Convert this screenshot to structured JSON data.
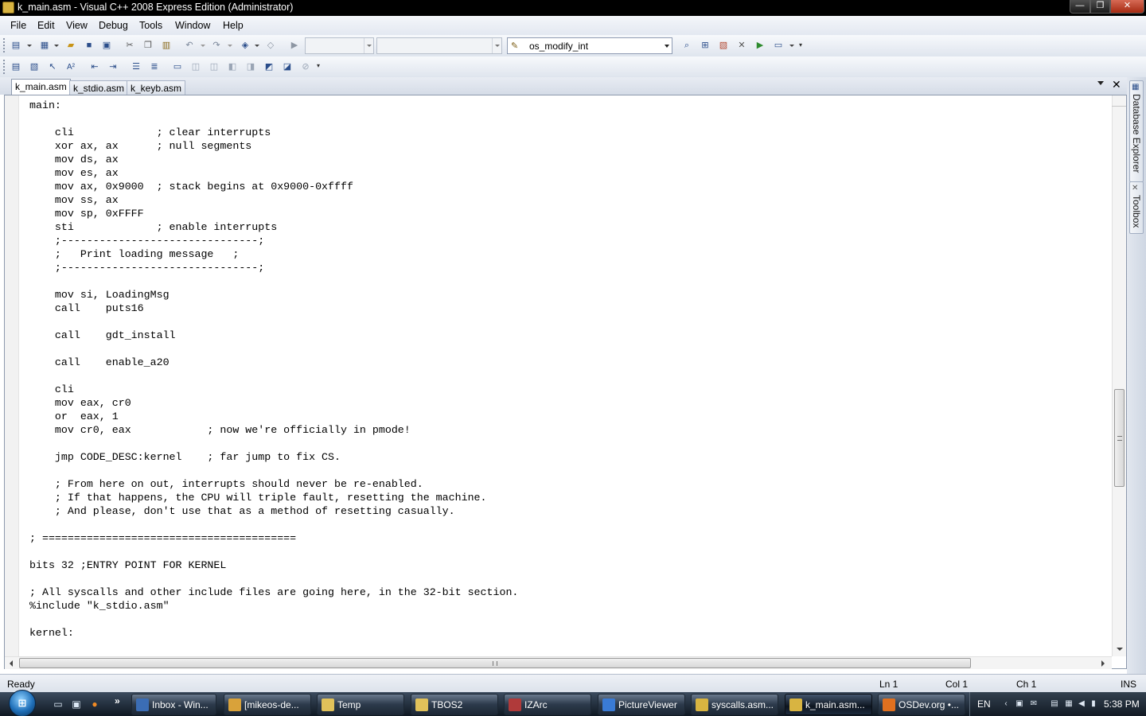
{
  "window": {
    "title": "k_main.asm - Visual C++ 2008 Express Edition (Administrator)",
    "minimize_glyph": "—",
    "maximize_glyph": "❐",
    "close_glyph": "✕"
  },
  "menu": {
    "items": [
      {
        "label": "File"
      },
      {
        "label": "Edit"
      },
      {
        "label": "View"
      },
      {
        "label": "Debug"
      },
      {
        "label": "Tools"
      },
      {
        "label": "Window"
      },
      {
        "label": "Help"
      }
    ]
  },
  "toolbar": {
    "find_value": "os_modify_int",
    "icons": [
      "new-project-icon",
      "add-item-icon",
      "open-file-icon",
      "save-icon",
      "save-all-icon",
      "cut-icon",
      "copy-icon",
      "paste-icon",
      "undo-icon",
      "redo-icon",
      "navigate-icon",
      "start-debug-icon",
      "find-in-files-icon",
      "solution-explorer-icon",
      "properties-icon",
      "toolbox-icon",
      "start-page-icon",
      "output-icon"
    ]
  },
  "tabs": [
    {
      "label": "k_main.asm",
      "active": true
    },
    {
      "label": "k_stdio.asm",
      "active": false
    },
    {
      "label": "k_keyb.asm",
      "active": false
    }
  ],
  "tab_controls": {
    "close_glyph": "✕"
  },
  "side_tabs": [
    {
      "label": "Database Explorer"
    },
    {
      "label": "Toolbox"
    }
  ],
  "code_lines": [
    "main:",
    "",
    "    cli             ; clear interrupts",
    "    xor ax, ax      ; null segments",
    "    mov ds, ax",
    "    mov es, ax",
    "    mov ax, 0x9000  ; stack begins at 0x9000-0xffff",
    "    mov ss, ax",
    "    mov sp, 0xFFFF",
    "    sti             ; enable interrupts",
    "    ;-------------------------------;",
    "    ;   Print loading message   ;",
    "    ;-------------------------------;",
    "",
    "    mov si, LoadingMsg",
    "    call    puts16",
    "",
    "    call    gdt_install",
    "",
    "    call    enable_a20",
    "",
    "    cli",
    "    mov eax, cr0",
    "    or  eax, 1",
    "    mov cr0, eax            ; now we're officially in pmode!",
    "",
    "    jmp CODE_DESC:kernel    ; far jump to fix CS.",
    "",
    "    ; From here on out, interrupts should never be re-enabled.",
    "    ; If that happens, the CPU will triple fault, resetting the machine.",
    "    ; And please, don't use that as a method of resetting casually.",
    "",
    "; ========================================",
    "",
    "bits 32 ;ENTRY POINT FOR KERNEL",
    "",
    "; All syscalls and other include files are going here, in the 32-bit section.",
    "%include \"k_stdio.asm\"",
    "",
    "kernel:"
  ],
  "status": {
    "state": "Ready",
    "line": "Ln 1",
    "col": "Col 1",
    "ch": "Ch 1",
    "mode": "INS"
  },
  "taskbar": {
    "more_glyph": "»",
    "buttons": [
      {
        "label": "Inbox - Win...",
        "icon_color": "#3b6db5"
      },
      {
        "label": "[mikeos-de...",
        "icon_color": "#d9a23a"
      },
      {
        "label": "Temp",
        "icon_color": "#e0c15a"
      },
      {
        "label": "TBOS2",
        "icon_color": "#e0c15a"
      },
      {
        "label": "IZArc",
        "icon_color": "#b03a3a"
      },
      {
        "label": "PictureViewer",
        "icon_color": "#3a7bd5"
      },
      {
        "label": "syscalls.asm...",
        "icon_color": "#d8b441"
      },
      {
        "label": "k_main.asm...",
        "icon_color": "#d8b441",
        "active": true
      },
      {
        "label": "OSDev.org •...",
        "icon_color": "#e0701f"
      }
    ],
    "tray": {
      "language": "EN",
      "clock": "5:38 PM"
    }
  }
}
